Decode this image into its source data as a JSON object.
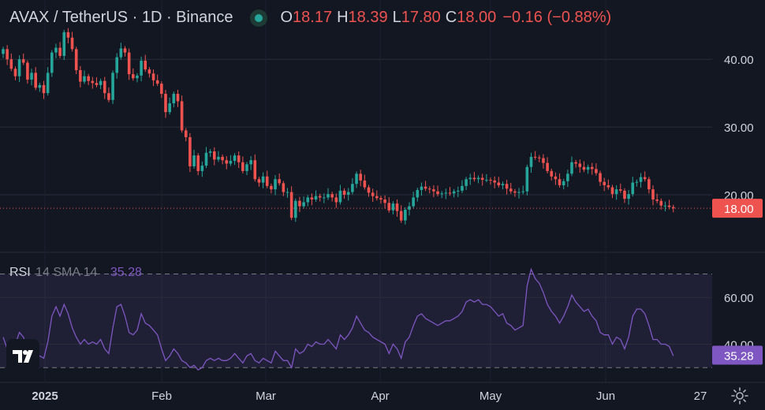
{
  "header": {
    "symbol": "AVAX / TetherUS · 1D · Binance",
    "open_key": "O",
    "open": "18.17",
    "high_key": "H",
    "high": "18.39",
    "low_key": "L",
    "low": "17.80",
    "close_key": "C",
    "close": "18.00",
    "change": "−0.16 (−0.88%)"
  },
  "rsi": {
    "label": "RSI",
    "params": "14 SMA 14",
    "value": "35.28"
  },
  "colors": {
    "up": "#26a69a",
    "down": "#ef5350",
    "rsi": "#7e57c2",
    "bg": "#131722",
    "grid": "#2a2e39",
    "text": "#d1d4dc"
  },
  "icons": {
    "logo": "tradingview-logo-icon",
    "settings": "gear-icon"
  },
  "chart_data": [
    {
      "type": "candlestick",
      "price_axis_ticks": [
        "40.00",
        "30.00",
        "20.00"
      ],
      "last_price_label": "18.00",
      "time_axis_ticks": [
        "2025",
        "Feb",
        "Mar",
        "Apr",
        "May",
        "Jun",
        "27"
      ],
      "ylim": [
        14,
        46
      ],
      "close": [
        41.5,
        40.0,
        38.6,
        37.5,
        40.0,
        39.5,
        37.0,
        38.0,
        35.8,
        36.2,
        35.0,
        38.0,
        41.0,
        41.7,
        40.5,
        44.0,
        43.2,
        41.5,
        38.4,
        36.7,
        37.5,
        36.8,
        36.5,
        36.2,
        36.8,
        35.0,
        34.0,
        38.0,
        40.3,
        41.6,
        41.0,
        37.8,
        37.2,
        37.6,
        39.8,
        38.5,
        37.9,
        36.9,
        36.4,
        34.9,
        32.2,
        33.5,
        34.9,
        33.8,
        29.5,
        28.5,
        24.2,
        25.8,
        23.5,
        24.3,
        26.2,
        26.4,
        25.2,
        25.6,
        25.1,
        24.6,
        25.0,
        25.8,
        24.8,
        23.5,
        24.5,
        25.1,
        22.3,
        21.8,
        22.7,
        21.3,
        20.8,
        22.3,
        21.7,
        20.4,
        20.4,
        16.6,
        19.1,
        18.3,
        18.9,
        19.6,
        19.3,
        19.8,
        19.6,
        19.6,
        20.1,
        19.6,
        18.9,
        20.6,
        20.0,
        20.4,
        21.6,
        23.1,
        22.1,
        21.1,
        20.3,
        19.8,
        19.5,
        19.3,
        18.8,
        17.7,
        18.7,
        17.6,
        16.2,
        17.8,
        18.3,
        19.6,
        20.7,
        21.2,
        20.9,
        20.8,
        20.5,
        20.1,
        20.2,
        20.3,
        20.2,
        20.5,
        20.6,
        21.3,
        22.3,
        22.5,
        22.3,
        22.5,
        22.2,
        22.2,
        22.1,
        21.8,
        21.4,
        21.6,
        20.9,
        20.5,
        20.3,
        20.4,
        20.5,
        24.1,
        25.6,
        25.5,
        25.4,
        24.7,
        23.5,
        22.7,
        22.3,
        21.4,
        22.0,
        23.1,
        24.8,
        24.6,
        24.1,
        23.7,
        24.1,
        23.8,
        23.2,
        21.9,
        21.4,
        21.1,
        20.1,
        20.8,
        20.6,
        19.4,
        20.1,
        21.8,
        21.9,
        22.6,
        22.3,
        20.8,
        19.3,
        19.1,
        18.4,
        18.4,
        18.2,
        18.0
      ],
      "open": [
        40.8,
        41.5,
        40.0,
        38.6,
        37.5,
        40.0,
        39.5,
        37.0,
        38.0,
        35.8,
        36.2,
        35.0,
        38.0,
        41.0,
        41.7,
        40.5,
        44.0,
        43.2,
        41.5,
        38.4,
        36.7,
        37.5,
        36.8,
        36.5,
        36.2,
        36.8,
        35.0,
        34.0,
        38.0,
        40.3,
        41.6,
        41.0,
        37.8,
        37.2,
        37.6,
        39.8,
        38.5,
        37.9,
        36.9,
        36.4,
        34.9,
        32.2,
        33.5,
        34.9,
        33.8,
        29.5,
        28.5,
        24.2,
        25.8,
        23.5,
        24.3,
        26.2,
        26.4,
        25.2,
        25.6,
        25.1,
        24.6,
        25.0,
        25.8,
        24.8,
        23.5,
        24.5,
        25.1,
        22.3,
        21.8,
        22.7,
        21.3,
        20.8,
        22.3,
        21.7,
        20.4,
        20.4,
        16.6,
        19.1,
        18.3,
        18.9,
        19.6,
        19.3,
        19.8,
        19.6,
        19.6,
        20.1,
        19.6,
        18.9,
        20.6,
        20.0,
        20.4,
        21.6,
        23.1,
        22.1,
        21.1,
        20.3,
        19.8,
        19.5,
        19.3,
        18.8,
        17.7,
        18.7,
        17.6,
        16.2,
        17.8,
        18.3,
        19.6,
        20.7,
        21.2,
        20.9,
        20.8,
        20.5,
        20.1,
        20.2,
        20.3,
        20.2,
        20.5,
        20.6,
        21.3,
        22.3,
        22.5,
        22.3,
        22.5,
        22.2,
        22.2,
        22.1,
        21.8,
        21.4,
        21.6,
        20.9,
        20.5,
        20.3,
        20.4,
        20.5,
        24.1,
        25.6,
        25.5,
        25.4,
        24.7,
        23.5,
        22.7,
        22.3,
        21.4,
        22.0,
        23.1,
        24.8,
        24.6,
        24.1,
        23.7,
        24.1,
        23.8,
        23.2,
        21.9,
        21.4,
        21.1,
        20.1,
        20.8,
        20.6,
        19.4,
        20.1,
        21.8,
        21.9,
        22.6,
        22.3,
        20.8,
        19.3,
        19.1,
        18.4,
        18.4,
        18.17
      ]
    },
    {
      "type": "line",
      "name": "RSI",
      "ylabel_ticks": [
        "60.00",
        "40.00"
      ],
      "ylim": [
        27,
        72
      ],
      "band": [
        30,
        70
      ],
      "values": [
        43,
        38,
        36,
        40,
        45,
        43,
        37,
        39,
        34,
        35,
        34,
        41,
        52,
        56,
        52,
        57,
        53,
        47,
        43,
        40,
        42,
        40,
        41,
        40,
        42,
        38,
        36,
        47,
        56,
        57,
        52,
        45,
        44,
        46,
        53,
        49,
        48,
        46,
        44,
        38,
        33,
        35,
        38,
        36,
        33,
        32,
        30,
        31,
        29,
        30,
        33,
        34,
        33,
        34,
        33,
        33,
        34,
        36,
        34,
        32,
        35,
        36,
        33,
        32,
        34,
        33,
        32,
        37,
        35,
        33,
        33,
        30,
        38,
        36,
        37,
        40,
        39,
        41,
        40,
        40,
        42,
        40,
        38,
        44,
        42,
        44,
        47,
        52,
        49,
        46,
        45,
        43,
        42,
        41,
        40,
        36,
        40,
        38,
        34,
        41,
        43,
        48,
        52,
        53,
        51,
        50,
        49,
        48,
        49,
        50,
        50,
        51,
        52,
        54,
        58,
        59,
        58,
        59,
        57,
        57,
        56,
        54,
        52,
        53,
        49,
        48,
        46,
        47,
        48,
        65,
        72,
        68,
        66,
        62,
        57,
        54,
        52,
        49,
        52,
        56,
        61,
        58,
        56,
        54,
        55,
        52,
        50,
        45,
        44,
        44,
        40,
        43,
        42,
        38,
        43,
        52,
        55,
        55,
        53,
        48,
        42,
        42,
        40,
        40,
        39,
        35
      ]
    }
  ]
}
